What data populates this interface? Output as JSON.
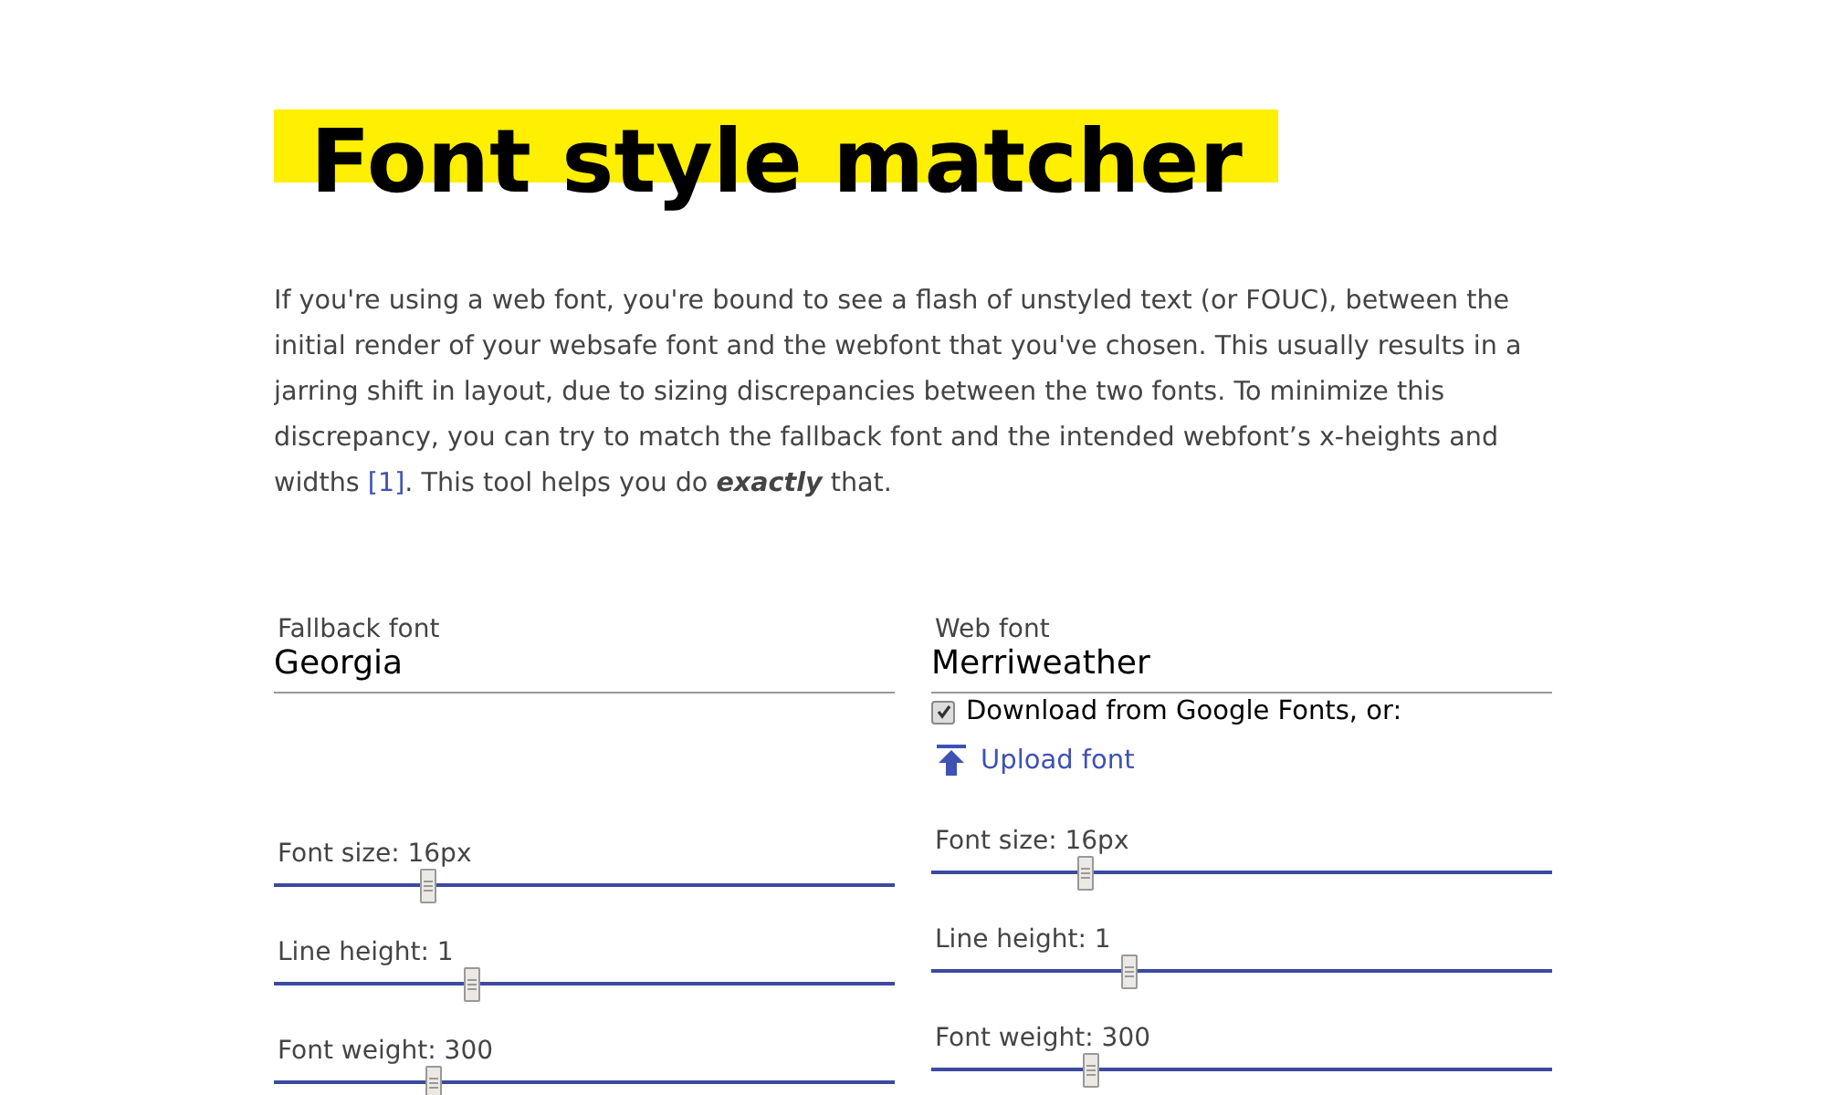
{
  "title": "Font style matcher",
  "intro": {
    "before": "If you're using a web font, you're bound to see a flash of unstyled text (or FOUC), between the initial render of your websafe font and the webfont that you've chosen. This usually results in a jarring shift in layout, due to sizing discrepancies between the two fonts. To minimize this discrepancy, you can try to match the fallback font and the intended webfont’s x-heights and widths ",
    "link": "[1]",
    "middle": ". This tool helps you do ",
    "emphasis": "exactly",
    "after": " that."
  },
  "columns": [
    {
      "label": "Fallback font",
      "value": "Georgia",
      "sliders": [
        {
          "label": "Font size: 16px",
          "level": 0.25
        },
        {
          "label": "Line height: 1",
          "level": 0.32
        },
        {
          "label": "Font weight: 300",
          "level": 0.26
        }
      ]
    },
    {
      "label": "Web font",
      "value": "Merriweather",
      "google": {
        "label": "Download from Google Fonts, or:",
        "checked": true
      },
      "upload": "Upload font",
      "sliders": [
        {
          "label": "Font size: 16px",
          "level": 0.25
        },
        {
          "label": "Line height: 1",
          "level": 0.32
        },
        {
          "label": "Font weight: 300",
          "level": 0.26
        }
      ]
    }
  ]
}
